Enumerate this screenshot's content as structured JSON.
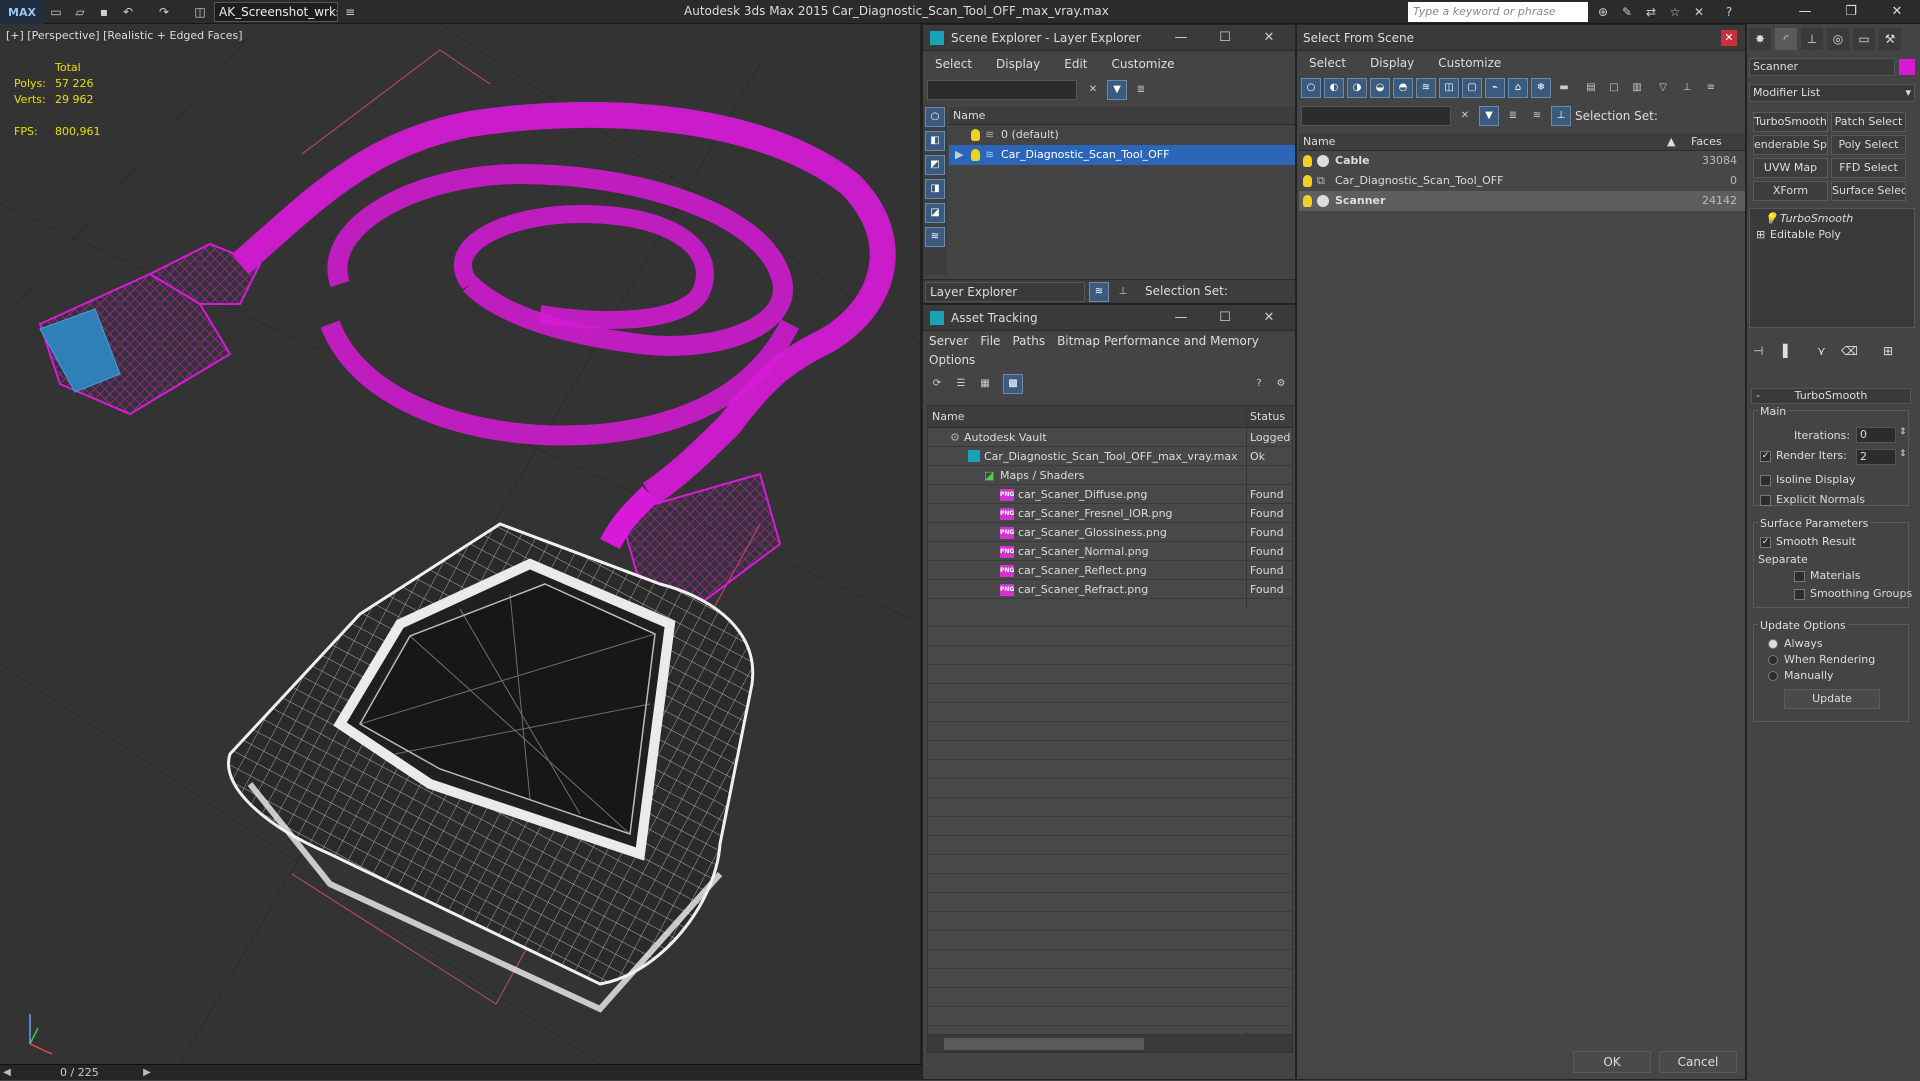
{
  "app": {
    "logo": "MAX",
    "workspace": "AK_Screenshot_wrksp",
    "title": "Autodesk 3ds Max  2015     Car_Diagnostic_Scan_Tool_OFF_max_vray.max",
    "search_placeholder": "Type a keyword or phrase"
  },
  "viewport": {
    "label": "[+] [Perspective] [Realistic + Edged Faces]",
    "stats_header": "Total",
    "polys_label": "Polys:",
    "polys": "57 226",
    "verts_label": "Verts:",
    "verts": "29 962",
    "fps_label": "FPS:",
    "fps": "800,961",
    "frame_counter": "0 / 225",
    "colors": {
      "background": "#333333",
      "cable_wire": "#d81ad8",
      "device_wire": "#f0f0f0",
      "connector": "#2f7fb8"
    }
  },
  "scene_explorer": {
    "title": "Scene Explorer - Layer Explorer",
    "menu": [
      "Select",
      "Display",
      "Edit",
      "Customize"
    ],
    "column_name": "Name",
    "rows": [
      {
        "label": "0 (default)"
      },
      {
        "label": "Car_Diagnostic_Scan_Tool_OFF"
      }
    ],
    "footer_dropdown": "Layer Explorer",
    "selection_set_label": "Selection Set:"
  },
  "asset_tracking": {
    "title": "Asset Tracking",
    "menu": [
      "Server",
      "File",
      "Paths",
      "Bitmap Performance and Memory"
    ],
    "menu2": "Options",
    "col_name": "Name",
    "col_status": "Status",
    "rows": [
      {
        "name": "Autodesk Vault",
        "status": "Logged"
      },
      {
        "name": "Car_Diagnostic_Scan_Tool_OFF_max_vray.max",
        "status": "Ok"
      },
      {
        "name": "Maps / Shaders",
        "status": ""
      },
      {
        "name": "car_Scaner_Diffuse.png",
        "status": "Found"
      },
      {
        "name": "car_Scaner_Fresnel_IOR.png",
        "status": "Found"
      },
      {
        "name": "car_Scaner_Glossiness.png",
        "status": "Found"
      },
      {
        "name": "car_Scaner_Normal.png",
        "status": "Found"
      },
      {
        "name": "car_Scaner_Reflect.png",
        "status": "Found"
      },
      {
        "name": "car_Scaner_Refract.png",
        "status": "Found"
      }
    ],
    "png_tag": "PNG"
  },
  "select_from_scene": {
    "title": "Select From Scene",
    "menu": [
      "Select",
      "Display",
      "Customize"
    ],
    "selection_set_label": "Selection Set:",
    "col_name": "Name",
    "col_faces": "Faces",
    "rows": [
      {
        "name": "Cable",
        "faces": "33084"
      },
      {
        "name": "Car_Diagnostic_Scan_Tool_OFF",
        "faces": "0"
      },
      {
        "name": "Scanner",
        "faces": "24142"
      }
    ],
    "ok": "OK",
    "cancel": "Cancel"
  },
  "command_panel": {
    "object_name": "Scanner",
    "object_color": "#d81ad8",
    "modifier_list": "Modifier List",
    "modifier_buttons": [
      "TurboSmooth",
      "Patch Select",
      "enderable Splir",
      "Poly Select",
      "UVW Map",
      "FFD Select",
      "XForm",
      "Surface Select"
    ],
    "stack": [
      "TurboSmooth",
      "Editable Poly"
    ],
    "rollout": "TurboSmooth",
    "main_label": "Main",
    "iterations_label": "Iterations:",
    "iterations": "0",
    "render_iters_label": "Render Iters:",
    "render_iters": "2",
    "isoline": "Isoline Display",
    "explicit_normals": "Explicit Normals",
    "surface_params": "Surface Parameters",
    "smooth_result": "Smooth Result",
    "separate": "Separate",
    "materials": "Materials",
    "smoothing_groups": "Smoothing Groups",
    "update_options": "Update Options",
    "always": "Always",
    "when_rendering": "When Rendering",
    "manually": "Manually",
    "update": "Update"
  }
}
